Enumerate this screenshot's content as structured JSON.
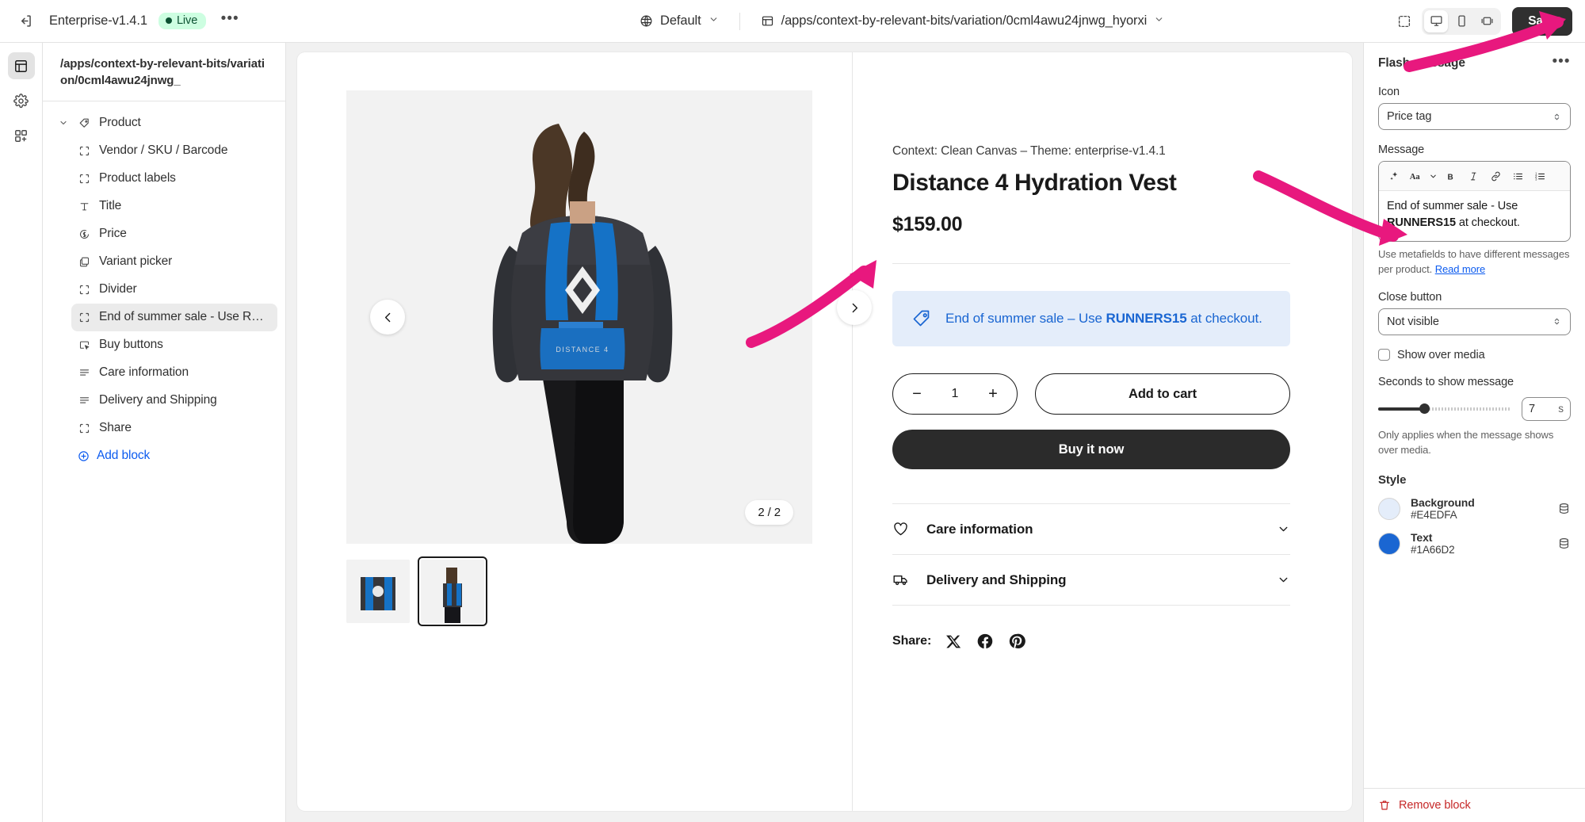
{
  "topbar": {
    "exit_icon": "exit-icon",
    "theme_name": "Enterprise-v1.4.1",
    "live_label": "Live",
    "more_label": "•••",
    "locale_icon": "globe-icon",
    "locale_label": "Default",
    "page_icon": "page-icon",
    "page_path": "/apps/context-by-relevant-bits/variation/0cml4awu24jnwg_hyorxi",
    "inspect_icon": "inspector-icon",
    "devices": [
      {
        "name": "desktop-icon",
        "active": true
      },
      {
        "name": "mobile-icon",
        "active": false
      },
      {
        "name": "fullwidth-icon",
        "active": false
      }
    ],
    "save_label": "Save"
  },
  "rail": {
    "items": [
      {
        "name": "sections-icon",
        "active": true
      },
      {
        "name": "settings-gear-icon",
        "active": false
      },
      {
        "name": "apps-icon",
        "active": false
      }
    ]
  },
  "sidebar": {
    "header_title": "/apps/context-by-relevant-bits/variation/0cml4awu24jnwg_",
    "group": {
      "label": "Product",
      "icon": "tag-icon"
    },
    "items": [
      {
        "label": "Vendor / SKU / Barcode",
        "icon": "block-icon",
        "selected": false
      },
      {
        "label": "Product labels",
        "icon": "block-icon",
        "selected": false
      },
      {
        "label": "Title",
        "icon": "text-icon",
        "selected": false
      },
      {
        "label": "Price",
        "icon": "price-icon",
        "selected": false
      },
      {
        "label": "Variant picker",
        "icon": "variant-icon",
        "selected": false
      },
      {
        "label": "Divider",
        "icon": "block-icon",
        "selected": false
      },
      {
        "label": "End of summer sale - Use RUN...",
        "icon": "block-icon",
        "selected": true
      },
      {
        "label": "Buy buttons",
        "icon": "buy-button-icon",
        "selected": false
      },
      {
        "label": "Care information",
        "icon": "list-icon",
        "selected": false
      },
      {
        "label": "Delivery and Shipping",
        "icon": "list-icon",
        "selected": false
      },
      {
        "label": "Share",
        "icon": "block-icon",
        "selected": false
      }
    ],
    "add_block_label": "Add block"
  },
  "product": {
    "context_line": "Context: Clean Canvas – Theme: enterprise-v1.4.1",
    "title": "Distance 4 Hydration Vest",
    "price": "$159.00",
    "gallery": {
      "counter": "2 / 2",
      "prev_icon": "chevron-left-icon",
      "next_icon": "chevron-right-icon"
    },
    "flash_banner": {
      "icon": "price-tag-icon",
      "text_before": "End of summer sale – Use ",
      "code": "RUNNERS15",
      "text_after": " at checkout."
    },
    "quantity": {
      "minus": "−",
      "value": "1",
      "plus": "+"
    },
    "add_to_cart_label": "Add to cart",
    "buy_now_label": "Buy it now",
    "accordions": [
      {
        "label": "Care information",
        "icon": "heart-icon"
      },
      {
        "label": "Delivery and Shipping",
        "icon": "truck-icon"
      }
    ],
    "share": {
      "label": "Share:",
      "icons": [
        "x-icon",
        "facebook-icon",
        "pinterest-icon"
      ]
    }
  },
  "inspector": {
    "title": "Flash message",
    "more_label": "•••",
    "icon_field": {
      "label": "Icon",
      "value": "Price tag"
    },
    "message_field": {
      "label": "Message",
      "toolbar": [
        "sparkle-icon",
        "text-style-icon",
        "chevron-down-icon",
        "bold-icon",
        "italic-icon",
        "link-icon",
        "bulleted-list-icon",
        "numbered-list-icon"
      ],
      "text_before": "End of summer sale - Use ",
      "bold_text": "RUNNERS15",
      "text_after": " at checkout.",
      "helper_text": "Use metafields to have different messages per product. ",
      "helper_link": "Read more"
    },
    "close_button_field": {
      "label": "Close button",
      "value": "Not visible"
    },
    "show_over_media": {
      "label": "Show over media",
      "checked": false
    },
    "seconds_field": {
      "label": "Seconds to show message",
      "value": "7",
      "unit": "s",
      "min": 0,
      "max": 30,
      "percent": 35,
      "helper": "Only applies when the message shows over media."
    },
    "style": {
      "title": "Style",
      "rows": [
        {
          "name": "Background",
          "value": "#E4EDFA",
          "swatch": "#E4EDFA",
          "source_icon": "database-icon"
        },
        {
          "name": "Text",
          "value": "#1A66D2",
          "swatch": "#1A66D2",
          "source_icon": "database-icon"
        }
      ]
    },
    "remove": {
      "label": "Remove block",
      "icon": "trash-icon"
    }
  },
  "annotations": {
    "color": "#E8187E"
  }
}
